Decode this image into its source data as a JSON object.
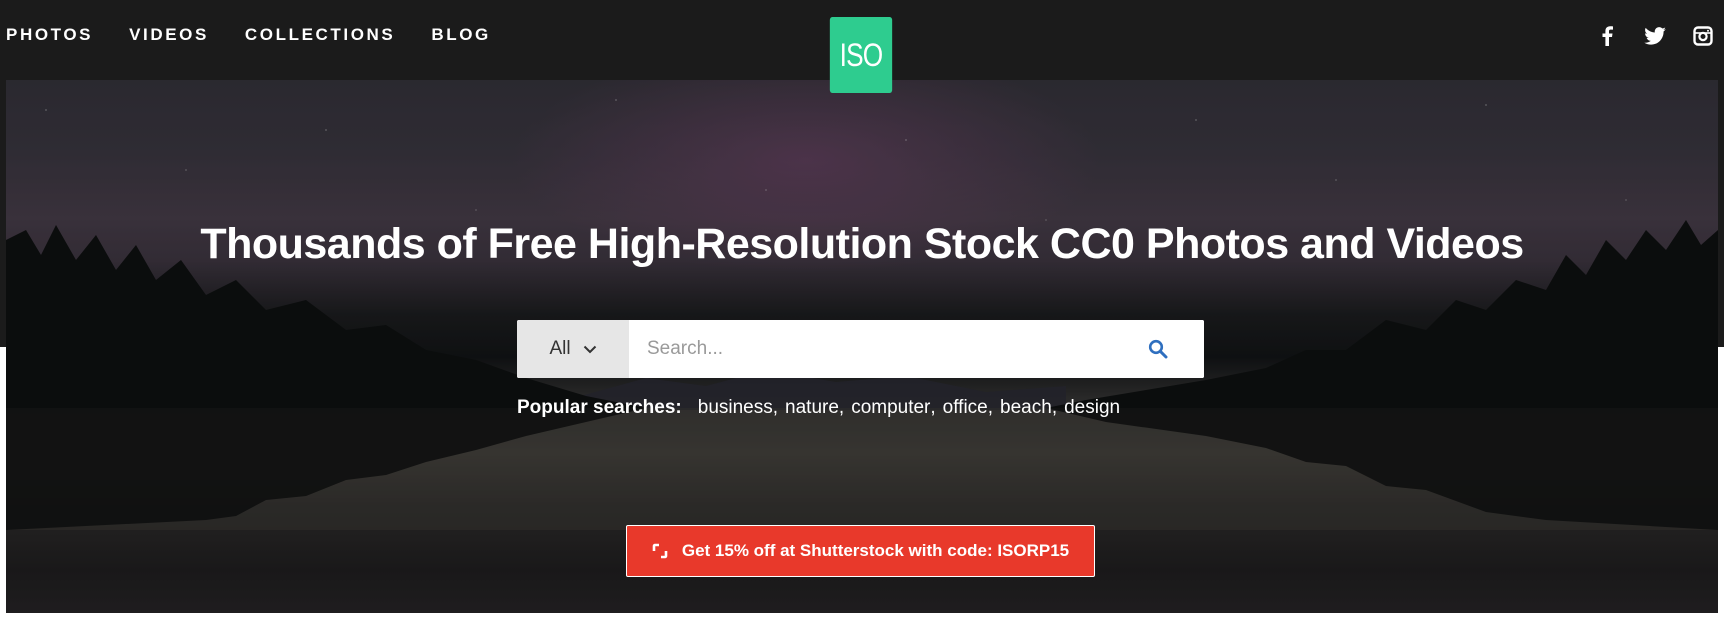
{
  "nav": {
    "items": [
      {
        "label": "PHOTOS"
      },
      {
        "label": "VIDEOS"
      },
      {
        "label": "COLLECTIONS"
      },
      {
        "label": "BLOG"
      }
    ]
  },
  "logo": {
    "text": "ISO",
    "color": "#2ecc8f"
  },
  "social": {
    "icons": [
      "facebook-icon",
      "twitter-icon",
      "instagram-icon"
    ]
  },
  "hero": {
    "title": "Thousands of Free High-Resolution Stock CC0 Photos and Videos",
    "search": {
      "scope_value": "All",
      "placeholder": "Search...",
      "button_icon": "search-icon",
      "accent_color": "#2f6fbf"
    },
    "popular": {
      "label": "Popular searches:",
      "terms": [
        "business",
        "nature",
        "computer",
        "office",
        "beach",
        "design"
      ]
    },
    "promo": {
      "label": "Get 15% off at Shutterstock with code: ISORP15",
      "color": "#e8392b",
      "icon": "shutterstock-icon"
    }
  }
}
